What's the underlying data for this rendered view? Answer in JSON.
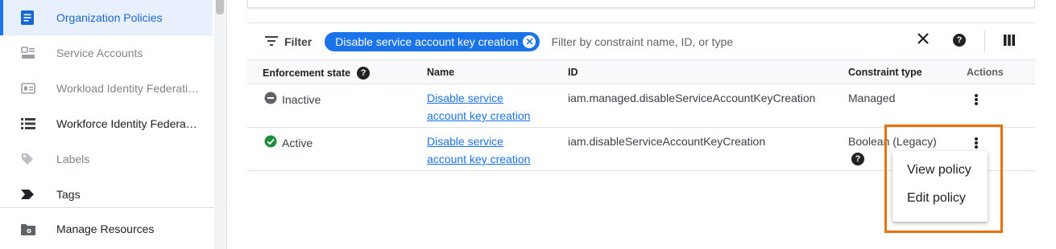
{
  "sidebar": {
    "items": [
      {
        "label": "Organization Policies",
        "icon": "policy-doc-icon"
      },
      {
        "label": "Service Accounts",
        "icon": "service-account-icon"
      },
      {
        "label": "Workload Identity Federati…",
        "icon": "id-card-icon"
      },
      {
        "label": "Workforce Identity Federa…",
        "icon": "list-icon"
      },
      {
        "label": "Labels",
        "icon": "label-tag-icon"
      },
      {
        "label": "Tags",
        "icon": "tag-arrow-icon"
      },
      {
        "label": "Manage Resources",
        "icon": "folder-gear-icon"
      }
    ]
  },
  "filter": {
    "label": "Filter",
    "chip_label": "Disable service account key creation",
    "input_placeholder": "Filter by constraint name, ID, or type"
  },
  "table": {
    "headers": {
      "enforcement_state": "Enforcement state",
      "name": "Name",
      "id": "ID",
      "constraint_type": "Constraint type",
      "actions": "Actions"
    },
    "rows": [
      {
        "state": "Inactive",
        "name": "Disable service account key creation",
        "id": "iam.managed.disableServiceAccountKeyCreation",
        "constraint_type": "Managed"
      },
      {
        "state": "Active",
        "name": "Disable service account key creation",
        "id": "iam.disableServiceAccountKeyCreation",
        "constraint_type": "Boolean (Legacy)"
      }
    ]
  },
  "menu": {
    "view_policy": "View policy",
    "edit_policy": "Edit policy"
  },
  "colors": {
    "accent": "#1a73e8",
    "active_green": "#1e8e3e",
    "highlight_orange": "#e8710a"
  }
}
